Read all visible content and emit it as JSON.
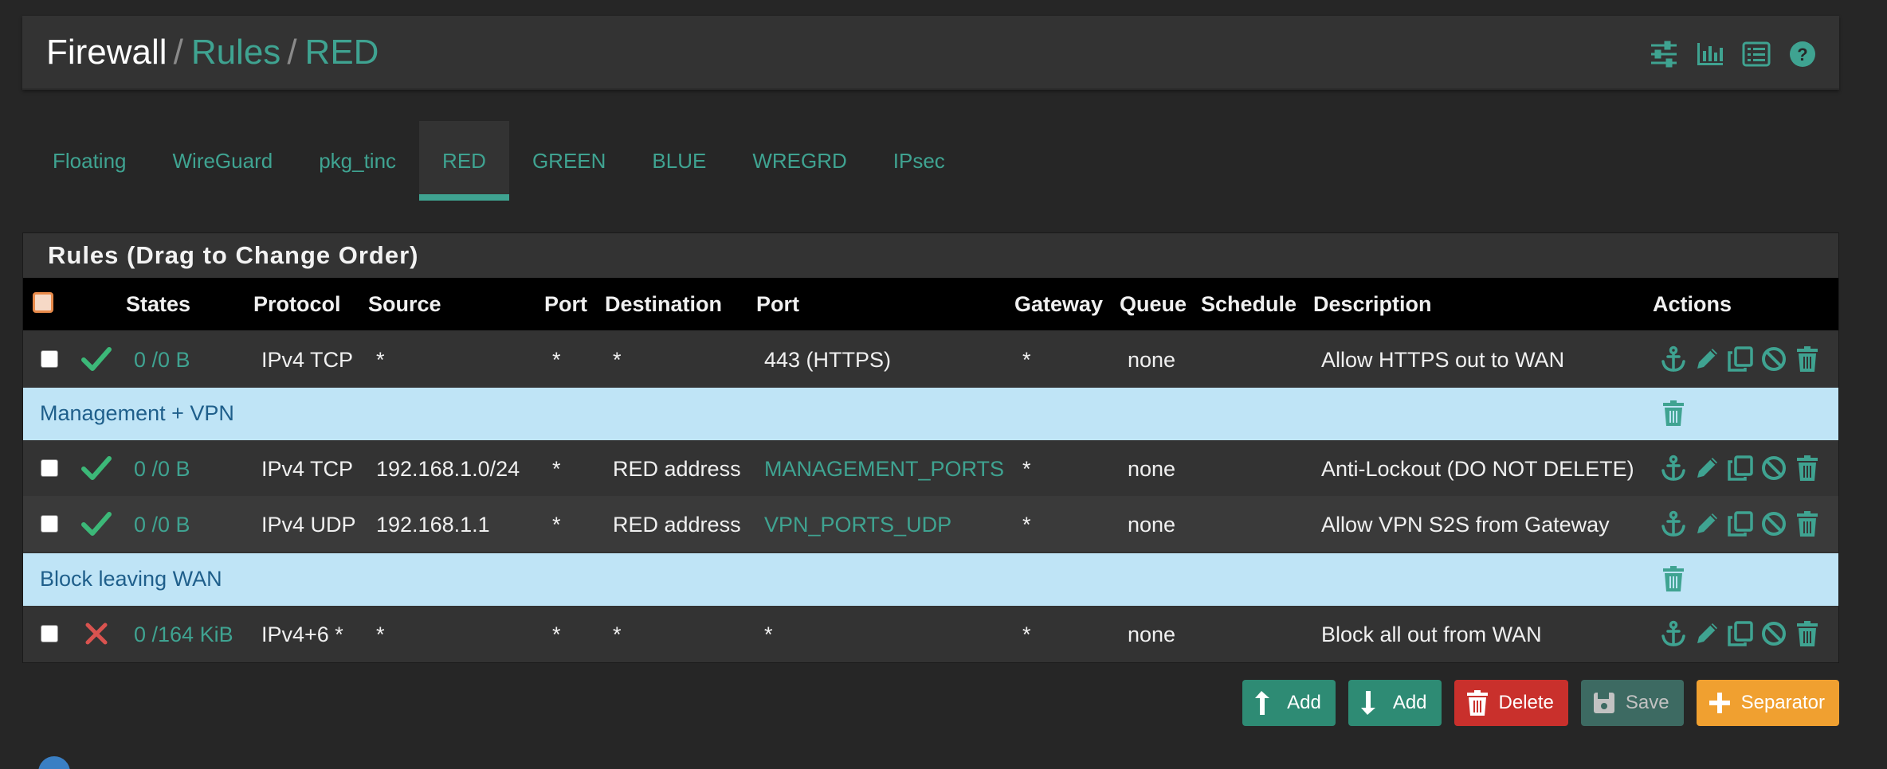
{
  "breadcrumb": {
    "root": "Firewall",
    "sep1": "/",
    "mid": "Rules",
    "sep2": "/",
    "current": "RED"
  },
  "header_icons": [
    "sliders-icon",
    "bar-chart-icon",
    "list-icon",
    "help-icon"
  ],
  "tabs": [
    {
      "label": "Floating"
    },
    {
      "label": "WireGuard"
    },
    {
      "label": "pkg_tinc"
    },
    {
      "label": "RED",
      "active": true
    },
    {
      "label": "GREEN"
    },
    {
      "label": "BLUE"
    },
    {
      "label": "WREGRD"
    },
    {
      "label": "IPsec"
    }
  ],
  "panel": {
    "title": "Rules (Drag to Change Order)"
  },
  "table": {
    "headers": {
      "states": "States",
      "protocol": "Protocol",
      "source": "Source",
      "port": "Port",
      "destination": "Destination",
      "dport": "Port",
      "gateway": "Gateway",
      "queue": "Queue",
      "schedule": "Schedule",
      "description": "Description",
      "actions": "Actions"
    },
    "rows": [
      {
        "status": "pass",
        "states": "0 /0 B",
        "protocol": "IPv4 TCP",
        "source": "*",
        "port": "*",
        "destination": "*",
        "dport": "443 (HTTPS)",
        "gateway": "*",
        "queue": "none",
        "schedule": "",
        "description": "Allow HTTPS out to WAN"
      },
      {
        "separator": "Management + VPN"
      },
      {
        "status": "pass",
        "states": "0 /0 B",
        "protocol": "IPv4 TCP",
        "source": "192.168.1.0/24",
        "port": "*",
        "destination": "RED address",
        "dport": "MANAGEMENT_PORTS",
        "gateway": "*",
        "queue": "none",
        "schedule": "",
        "description": "Anti-Lockout (DO NOT DELETE)"
      },
      {
        "status": "pass",
        "states": "0 /0 B",
        "protocol": "IPv4 UDP",
        "source": "192.168.1.1",
        "port": "*",
        "destination": "RED address",
        "dport": "VPN_PORTS_UDP",
        "gateway": "*",
        "queue": "none",
        "schedule": "",
        "description": "Allow VPN S2S from Gateway"
      },
      {
        "separator": "Block leaving WAN"
      },
      {
        "status": "block",
        "states": "0 /164 KiB",
        "protocol": "IPv4+6 *",
        "source": "*",
        "port": "*",
        "destination": "*",
        "dport": "*",
        "gateway": "*",
        "queue": "none",
        "schedule": "",
        "description": "Block all out from WAN"
      }
    ]
  },
  "buttons": {
    "add_top": "Add",
    "add_bottom": "Add",
    "delete": "Delete",
    "save": "Save",
    "separator": "Separator"
  },
  "colors": {
    "accent": "#3fa391",
    "separator_bg": "#bfe4f6",
    "pass": "#3cb878",
    "block": "#d9534f",
    "delete": "#c9302c",
    "separator_button": "#f0a030"
  }
}
